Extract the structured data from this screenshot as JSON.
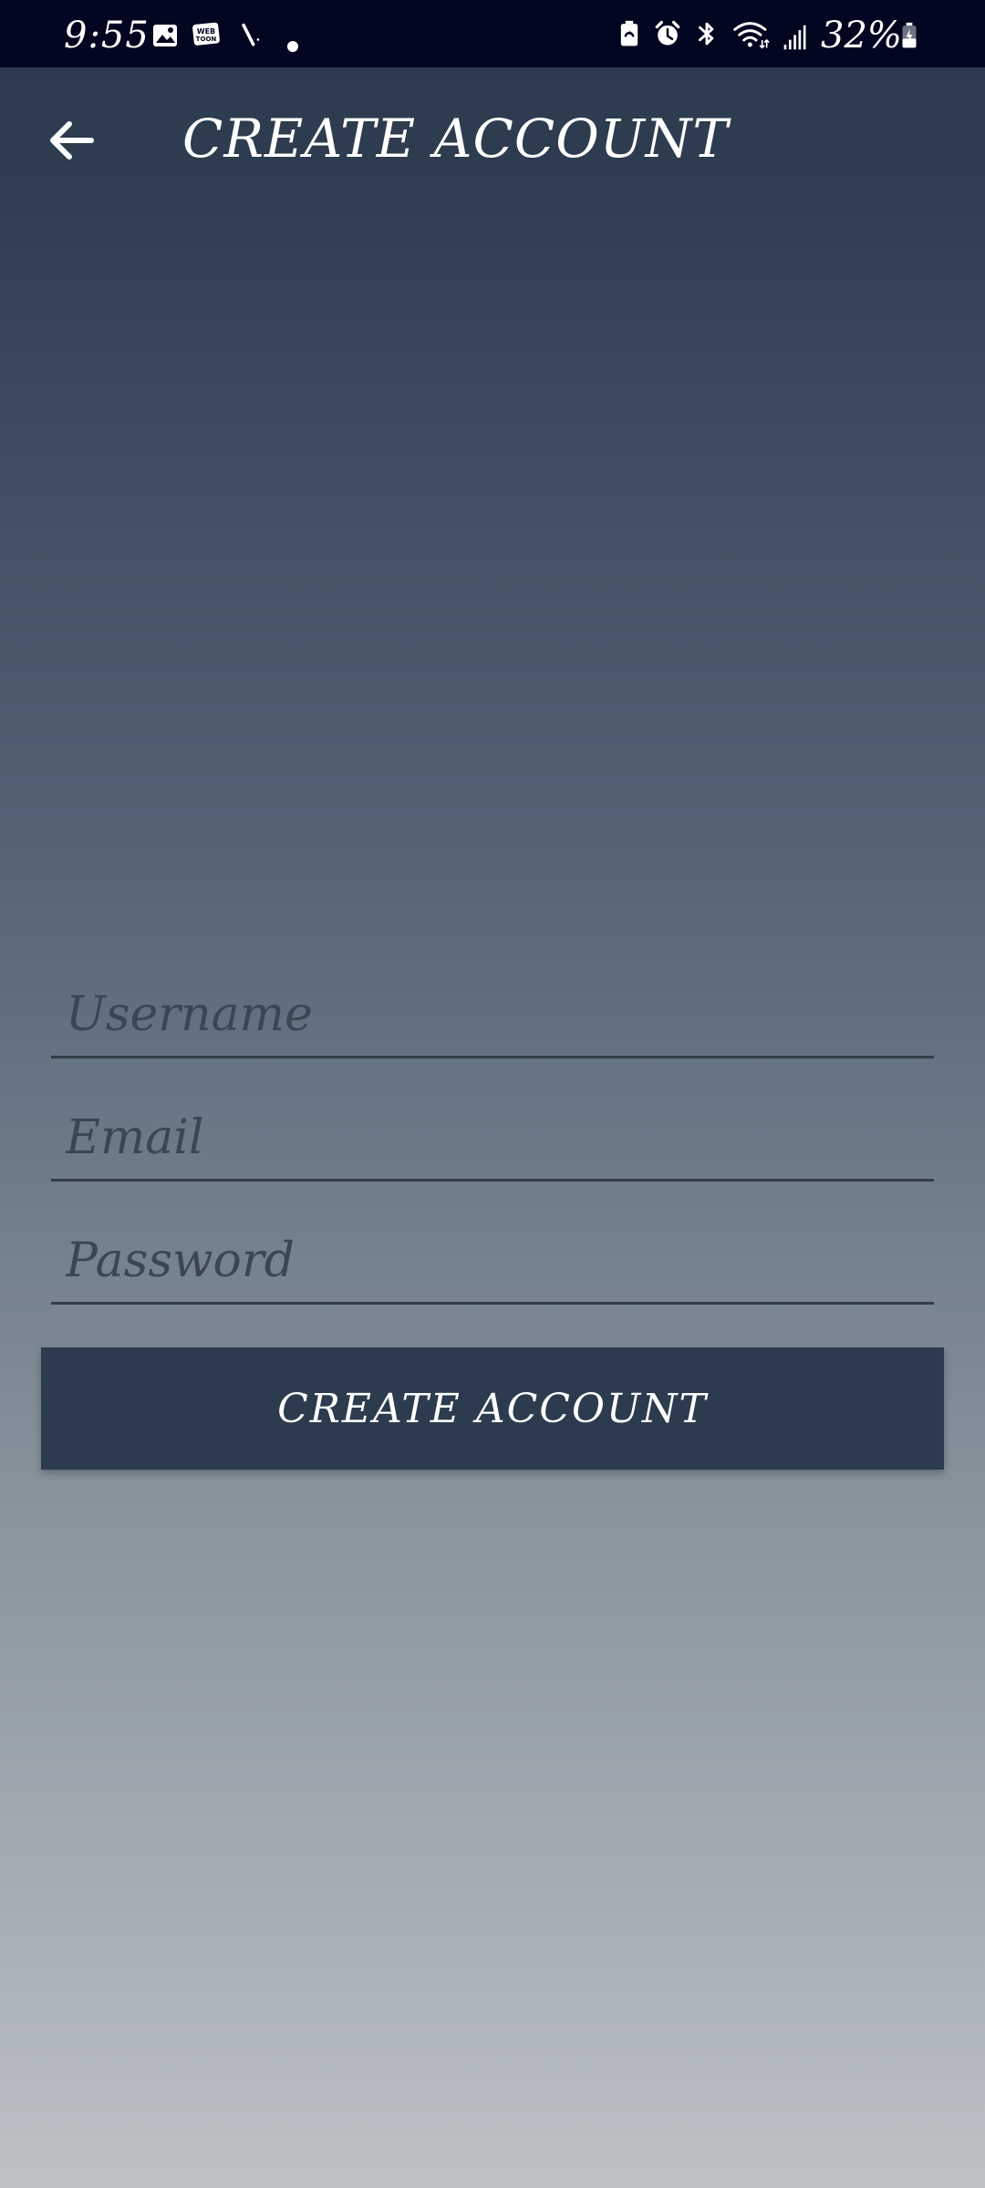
{
  "status_bar": {
    "time": "9:55",
    "battery": "32%",
    "left_icons": [
      "gallery-icon",
      "webtoon-icon",
      "slash-icon",
      "dot-icon"
    ],
    "right_icons": [
      "battery-saver-icon",
      "alarm-icon",
      "bluetooth-icon",
      "wifi-icon",
      "signal-icon",
      "battery-icon"
    ],
    "background": "#020621"
  },
  "app_bar": {
    "title": "CREATE ACCOUNT",
    "back_icon": "arrow-left-icon"
  },
  "form": {
    "username": {
      "value": "",
      "placeholder": "Username"
    },
    "email": {
      "value": "",
      "placeholder": "Email"
    },
    "password": {
      "value": "",
      "placeholder": "Password"
    },
    "submit_label": "CREATE ACCOUNT"
  },
  "colors": {
    "primary": "#2c3b4e",
    "gradient_bottom": "#bcc1c5",
    "field_line": "#333d47"
  }
}
